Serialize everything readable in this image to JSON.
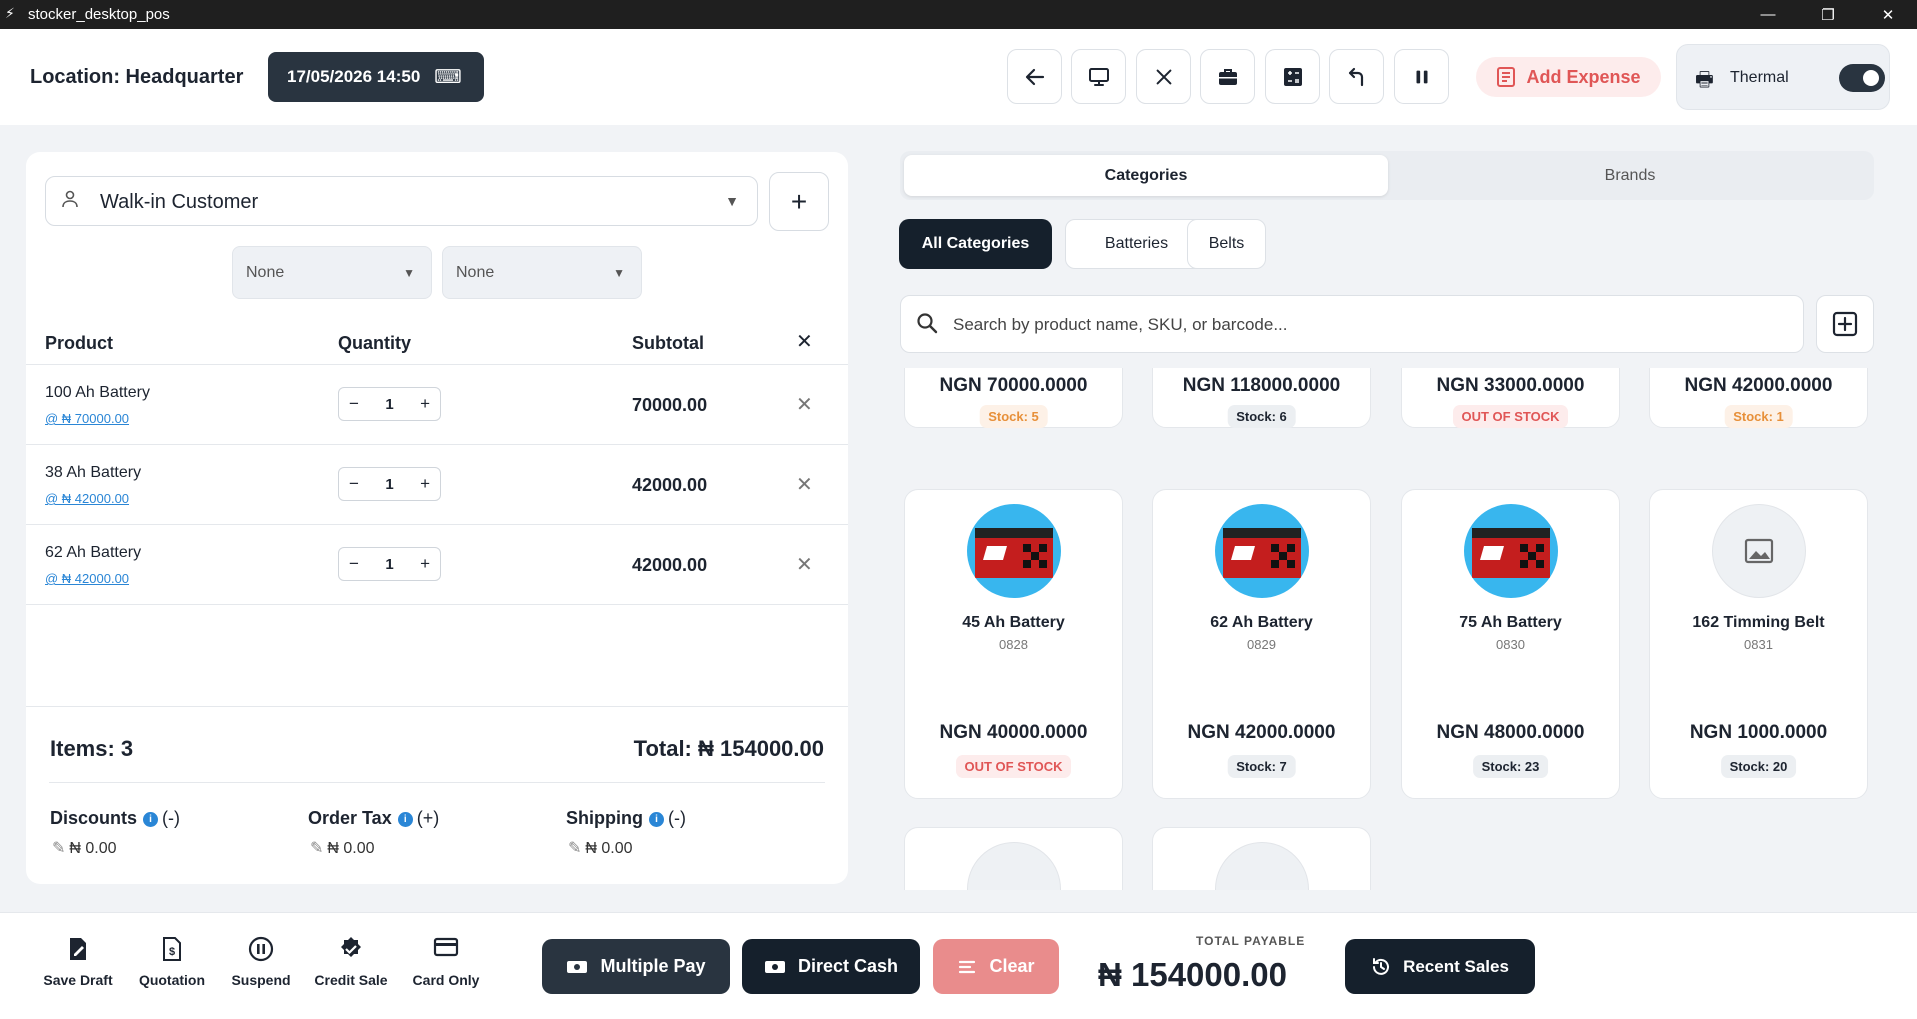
{
  "window": {
    "title": "stocker_desktop_pos",
    "app_icon": "app-logo-icon"
  },
  "header": {
    "location": "Location: Headquarter",
    "datetime": "17/05/2026 14:50",
    "tools": [
      "back-arrow-icon",
      "monitor-icon",
      "close-icon",
      "briefcase-icon",
      "calculator-icon",
      "undo-icon",
      "pause-icon"
    ],
    "add_expense": "Add Expense",
    "printer_label": "Thermal",
    "printer_toggle_on": true,
    "colors": {
      "dark": "#293440",
      "danger": "#e05656",
      "accent": "#2a86d6"
    }
  },
  "cart": {
    "customer": "Walk-in Customer",
    "selects": [
      "None",
      "None"
    ],
    "headers": {
      "product": "Product",
      "quantity": "Quantity",
      "subtotal": "Subtotal"
    },
    "items": [
      {
        "name": "100 Ah Battery",
        "unit": "@ ₦ 70000.00",
        "qty": "1",
        "subtotal": "70000.00"
      },
      {
        "name": "38 Ah Battery",
        "unit": "@ ₦ 42000.00",
        "qty": "1",
        "subtotal": "42000.00"
      },
      {
        "name": "62 Ah Battery",
        "unit": "@ ₦ 42000.00",
        "qty": "1",
        "subtotal": "42000.00"
      }
    ],
    "items_count": "Items: 3",
    "total": "Total: ₦ 154000.00",
    "discounts": {
      "label": "Discounts",
      "sign": "(-)",
      "value": "₦ 0.00"
    },
    "order_tax": {
      "label": "Order Tax",
      "sign": "(+)",
      "value": "₦ 0.00"
    },
    "shipping": {
      "label": "Shipping",
      "sign": "(-)",
      "value": "₦ 0.00"
    }
  },
  "catalog": {
    "tabs": [
      "Categories",
      "Brands"
    ],
    "chips": [
      "All Categories",
      "Batteries",
      "Belts"
    ],
    "search_placeholder": "Search by product name, SKU, or barcode...",
    "top_row": [
      {
        "price": "NGN 70000.0000",
        "stock": "Stock: 5",
        "status": "low"
      },
      {
        "price": "NGN 118000.0000",
        "stock": "Stock: 6",
        "status": "ok"
      },
      {
        "price": "NGN 33000.0000",
        "stock": "OUT OF STOCK",
        "status": "out"
      },
      {
        "price": "NGN 42000.0000",
        "stock": "Stock: 1",
        "status": "low"
      }
    ],
    "products": [
      {
        "name": "45 Ah Battery",
        "sku": "0828",
        "price": "NGN 40000.0000",
        "stock": "OUT OF STOCK",
        "status": "out",
        "image": "battery"
      },
      {
        "name": "62 Ah Battery",
        "sku": "0829",
        "price": "NGN 42000.0000",
        "stock": "Stock: 7",
        "status": "ok",
        "image": "battery"
      },
      {
        "name": "75 Ah Battery",
        "sku": "0830",
        "price": "NGN 48000.0000",
        "stock": "Stock: 23",
        "status": "ok",
        "image": "battery"
      },
      {
        "name": "162 Timming Belt",
        "sku": "0831",
        "price": "NGN 1000.0000",
        "stock": "Stock: 20",
        "status": "ok",
        "image": "placeholder"
      }
    ]
  },
  "footer": {
    "actions": [
      {
        "label": "Save Draft",
        "icon": "edit-document-icon"
      },
      {
        "label": "Quotation",
        "icon": "quotation-icon"
      },
      {
        "label": "Suspend",
        "icon": "pause-circle-icon"
      },
      {
        "label": "Credit Sale",
        "icon": "verified-badge-icon"
      },
      {
        "label": "Card Only",
        "icon": "credit-card-icon"
      }
    ],
    "multiple_pay": "Multiple Pay",
    "direct_cash": "Direct Cash",
    "clear": "Clear",
    "total_payable_label": "TOTAL PAYABLE",
    "total_payable": "₦ 154000.00",
    "recent_sales": "Recent Sales"
  }
}
